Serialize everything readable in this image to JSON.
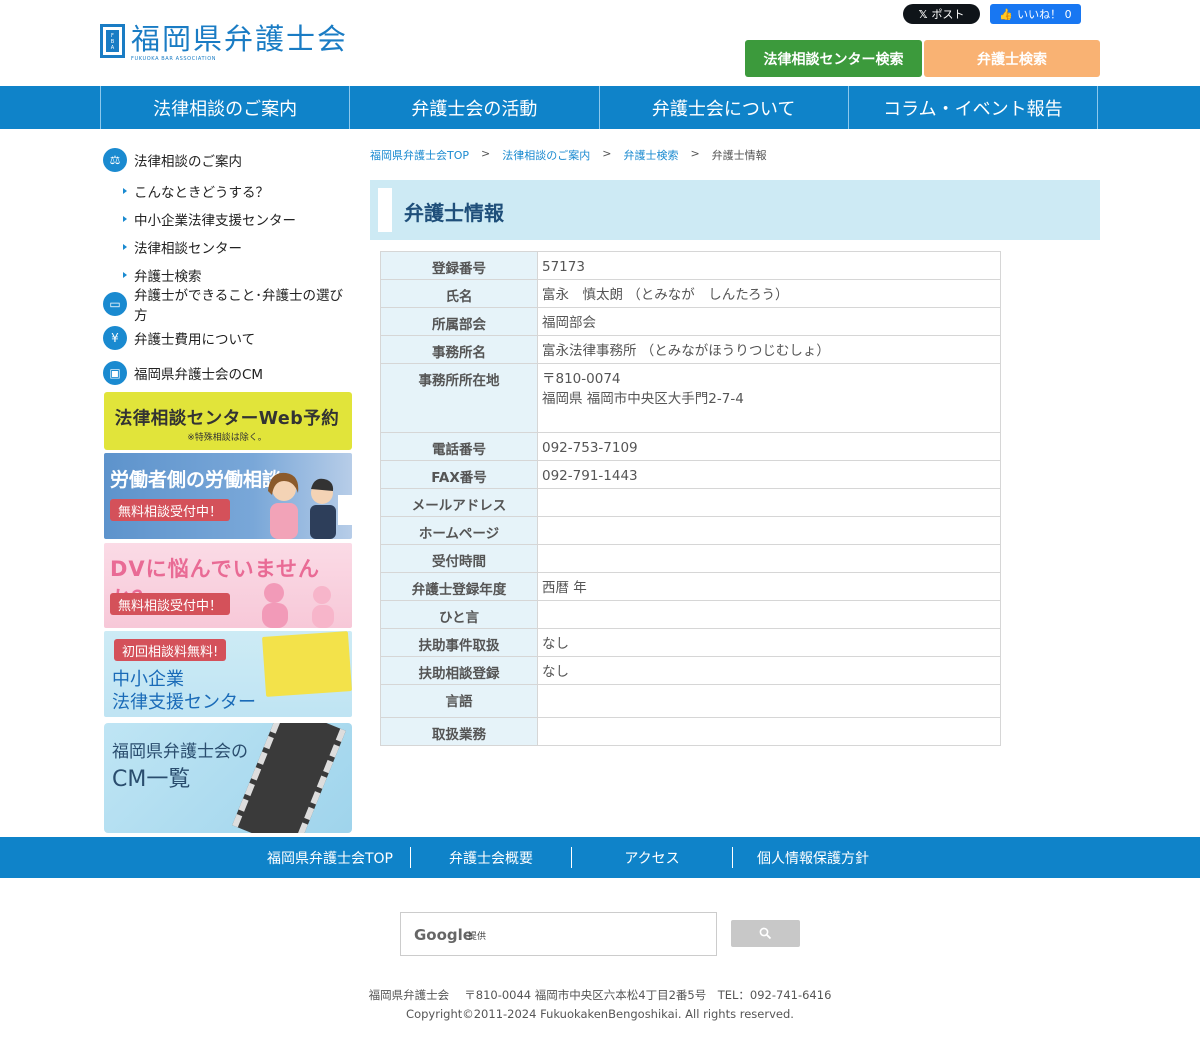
{
  "header": {
    "logo_title": "福岡県弁護士会",
    "logo_sub": "FUKUOKA BAR ASSOCIATION",
    "sns_x": "ポスト",
    "sns_fb": "いいね！ 0",
    "btn_center_search": "法律相談センター検索",
    "btn_lawyer_search": "弁護士検索"
  },
  "gnav": [
    "法律相談のご案内",
    "弁護士会の活動",
    "弁護士会について",
    "コラム・イベント報告"
  ],
  "sidebar": {
    "main1": "法律相談のご案内",
    "sub": [
      "こんなときどうする？",
      "中小企業法律支援センター",
      "法律相談センター",
      "弁護士検索"
    ],
    "main2": "弁護士ができること･弁護士の選び方",
    "main3": "弁護士費用について",
    "main4": "福岡県弁護士会のCM",
    "banner1_title": "法律相談センターWeb予約",
    "banner1_note": "※特殊相談は除く。",
    "banner2_title": "労働者側の労働相談",
    "banner2_tag": "無料相談受付中！",
    "banner3_title": "DVに悩んでいませんか？",
    "banner3_tag": "無料相談受付中！",
    "banner4_tag": "初回相談料無料!",
    "banner4_line1": "中小企業",
    "banner4_line2": "法律支援センター",
    "banner5_line1": "福岡県弁護士会の",
    "banner5_line2": "CM一覧"
  },
  "breadcrumb": {
    "items": [
      "福岡県弁護士会TOP",
      "法律相談のご案内",
      "弁護士検索"
    ],
    "current": "弁護士情報",
    "sep": ">"
  },
  "page": {
    "title": "弁護士情報"
  },
  "lawyer": {
    "rows": [
      {
        "label": "登録番号",
        "value": "57173"
      },
      {
        "label": "氏名",
        "value": "富永　慎太朗 （とみなが　しんたろう）"
      },
      {
        "label": "所属部会",
        "value": "福岡部会"
      },
      {
        "label": "事務所名",
        "value": "富永法律事務所 （とみながほうりつじむしょ）"
      },
      {
        "label": "事務所所在地",
        "value": "〒810-0074",
        "value2": "福岡県 福岡市中央区大手門2-7-4"
      },
      {
        "label": "電話番号",
        "value": "092-753-7109"
      },
      {
        "label": "FAX番号",
        "value": "092-791-1443"
      },
      {
        "label": "メールアドレス",
        "value": ""
      },
      {
        "label": "ホームページ",
        "value": ""
      },
      {
        "label": "受付時間",
        "value": ""
      },
      {
        "label": "弁護士登録年度",
        "value": "西暦 年"
      },
      {
        "label": "ひと言",
        "value": ""
      },
      {
        "label": "扶助事件取扱",
        "value": "なし"
      },
      {
        "label": "扶助相談登録",
        "value": "なし"
      },
      {
        "label": "言語",
        "value": ""
      },
      {
        "label": "取扱業務",
        "value": ""
      }
    ]
  },
  "footer": {
    "nav": [
      "福岡県弁護士会TOP",
      "弁護士会概要",
      "アクセス",
      "個人情報保護方針"
    ],
    "search_brand": "Google",
    "search_by": "提供",
    "address": "福岡県弁護士会　 〒810-0044 福岡市中央区六本松4丁目2番5号　TEL：092-741-6416",
    "copyright": "Copyright©2011-2024 FukuokakenBengoshikai. All rights reserved."
  },
  "colors": {
    "nav_blue": "#0f83c9",
    "green_button": "#3c9a3c",
    "orange_button": "#f9b273",
    "heading_bg": "#cdeaf4",
    "table_header_bg": "#e6f3f9"
  }
}
